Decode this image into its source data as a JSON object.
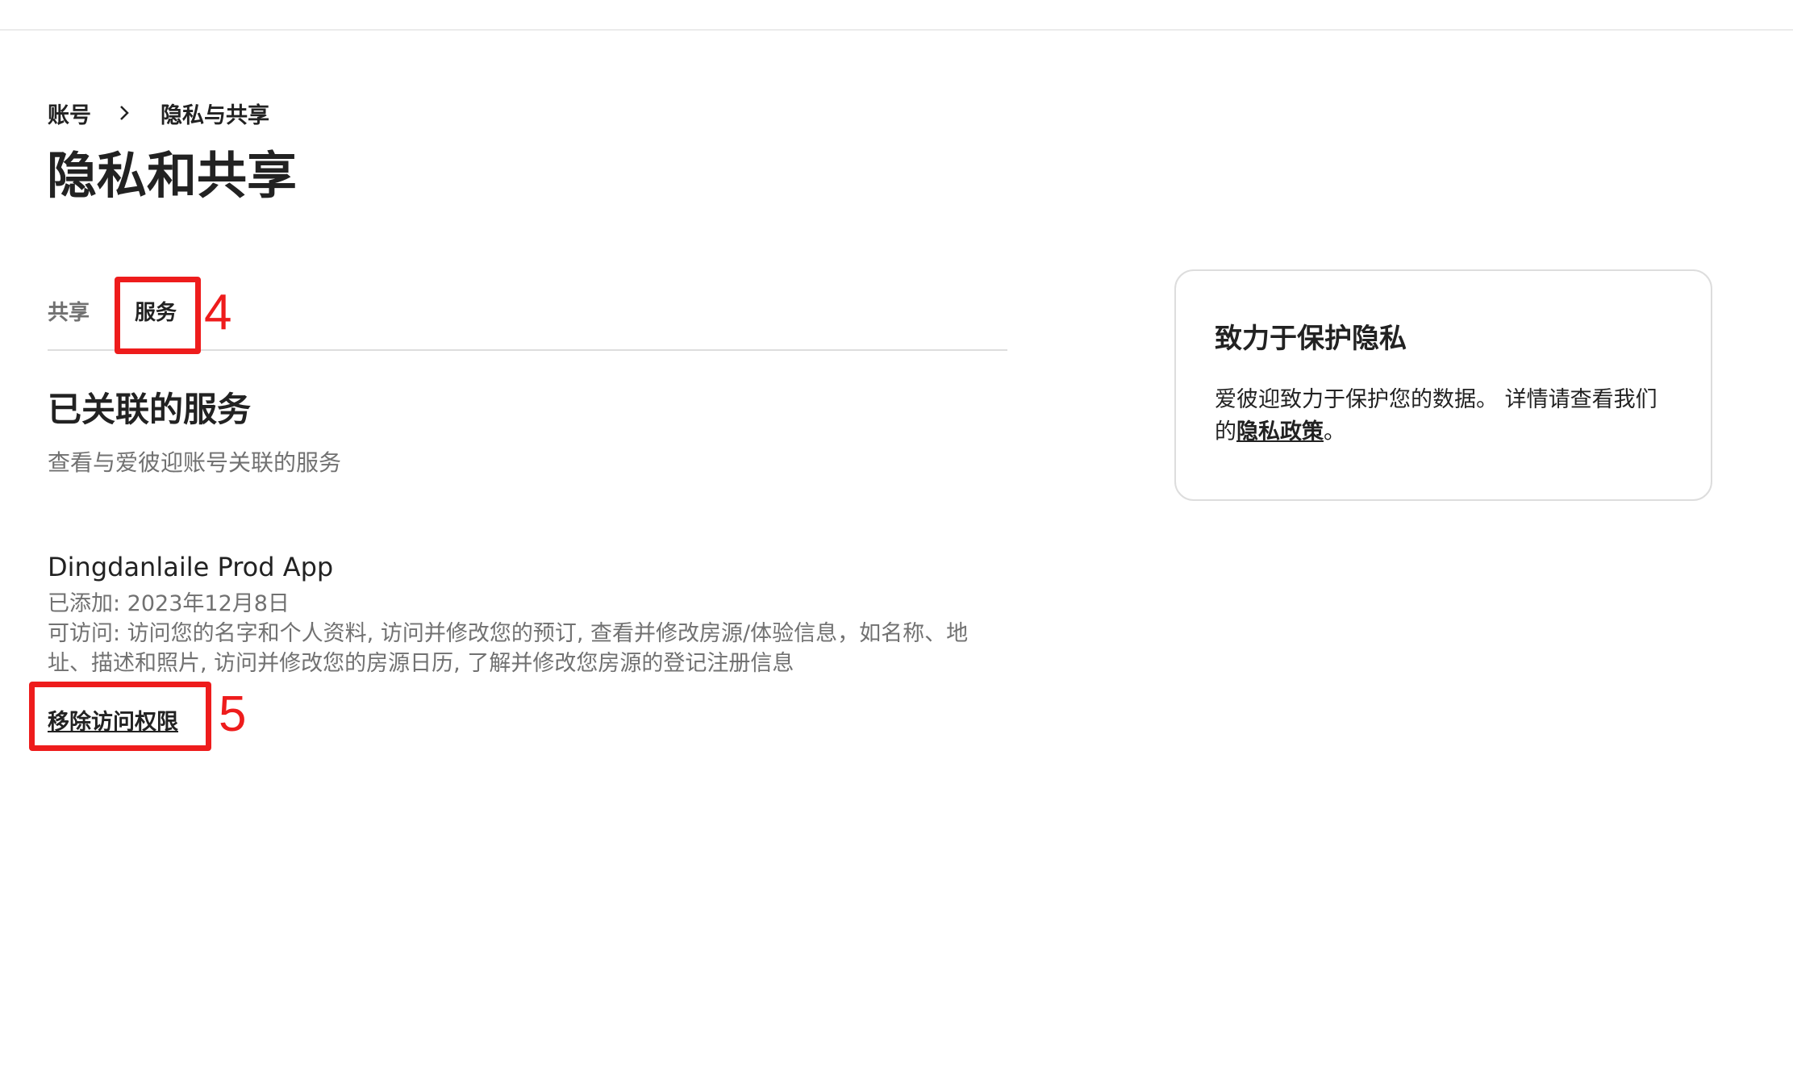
{
  "breadcrumb": {
    "items": [
      "账号",
      "隐私与共享"
    ],
    "separator_icon": "chevron-right-icon"
  },
  "page_title": "隐私和共享",
  "tabs": [
    {
      "label": "共享",
      "selected": false
    },
    {
      "label": "服务",
      "selected": true
    }
  ],
  "annotations": [
    "4",
    "5"
  ],
  "section": {
    "title": "已关联的服务",
    "subtitle": "查看与爱彼迎账号关联的服务"
  },
  "service": {
    "name": "Dingdanlaile Prod App",
    "added": "已添加: 2023年12月8日",
    "access_line1": "可访问: 访问您的名字和个人资料, 访问并修改您的预订, 查看并修改房源/体验信息，如名称、地",
    "access_line2": "址、描述和照片, 访问并修改您的房源日历, 了解并修改您房源的登记注册信息",
    "remove_label": "移除访问权限"
  },
  "privacy_card": {
    "title": "致力于保护隐私",
    "text_line1": "爱彼迎致力于保护您的数据。 详情请查看我们",
    "text_prefix": "的",
    "link_label": "隐私政策",
    "text_suffix": "。"
  },
  "colors": {
    "annotation": "#ee1c1c",
    "text_primary": "#222222",
    "text_secondary": "#717171",
    "divider": "#dddddd"
  }
}
